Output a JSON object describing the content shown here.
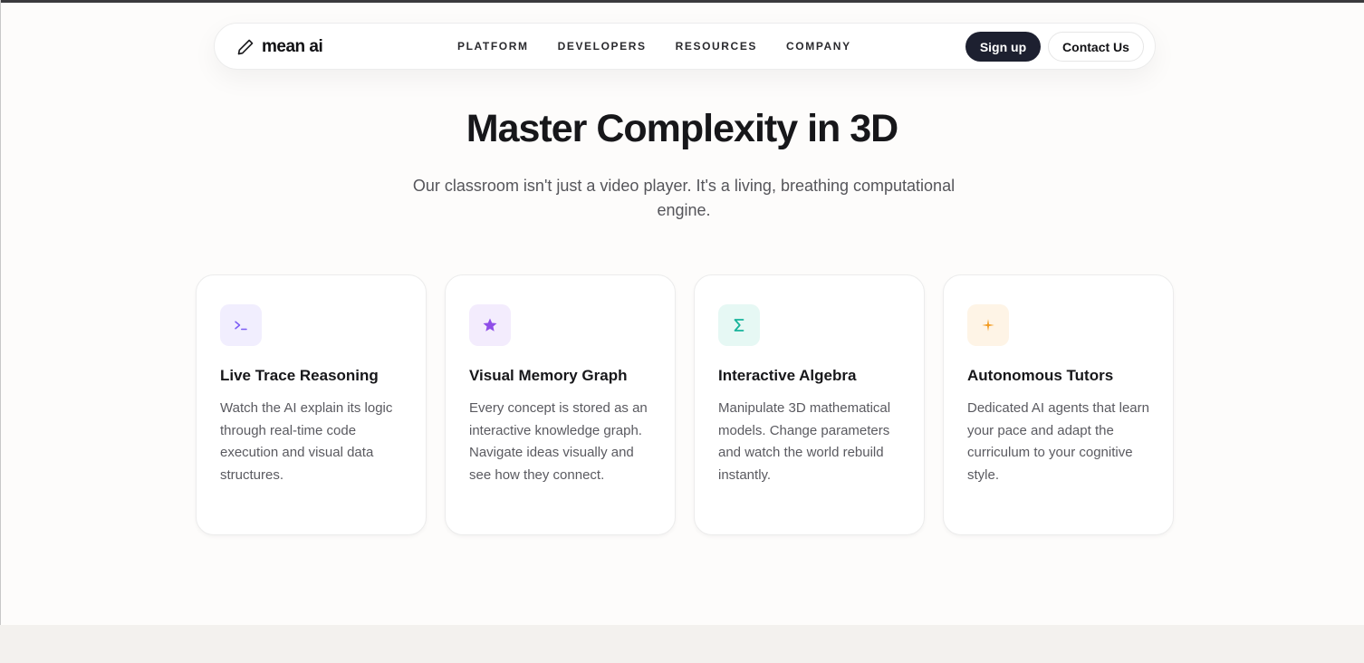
{
  "brand": {
    "name": "mean ai",
    "icon": "pen-icon"
  },
  "nav": {
    "links": [
      "PLATFORM",
      "DEVELOPERS",
      "RESOURCES",
      "COMPANY"
    ],
    "signup_label": "Sign up",
    "contact_label": "Contact Us"
  },
  "hero": {
    "title": "Master Complexity in 3D",
    "subtitle": "Our classroom isn't just a video player. It's a living, breathing computational engine."
  },
  "features": [
    {
      "icon": "terminal-icon",
      "icon_color": "#7b5cf5",
      "icon_bg": "#f1eefe",
      "title": "Live Trace Reasoning",
      "description": "Watch the AI explain its logic through real-time code execution and visual data structures."
    },
    {
      "icon": "star-icon",
      "icon_color": "#8f4ee8",
      "icon_bg": "#f3ecfd",
      "title": "Visual Memory Graph",
      "description": "Every concept is stored as an interactive knowledge graph. Navigate ideas visually and see how they connect."
    },
    {
      "icon": "sigma-icon",
      "icon_color": "#17b39a",
      "icon_bg": "#e6f8f4",
      "title": "Interactive Algebra",
      "description": "Manipulate 3D mathematical models. Change parameters and watch the world rebuild instantly."
    },
    {
      "icon": "sparkle-icon",
      "icon_color": "#f29a1f",
      "icon_bg": "#fef4e6",
      "title": "Autonomous Tutors",
      "description": "Dedicated AI agents that learn your pace and adapt the curriculum to your cognitive style."
    }
  ]
}
